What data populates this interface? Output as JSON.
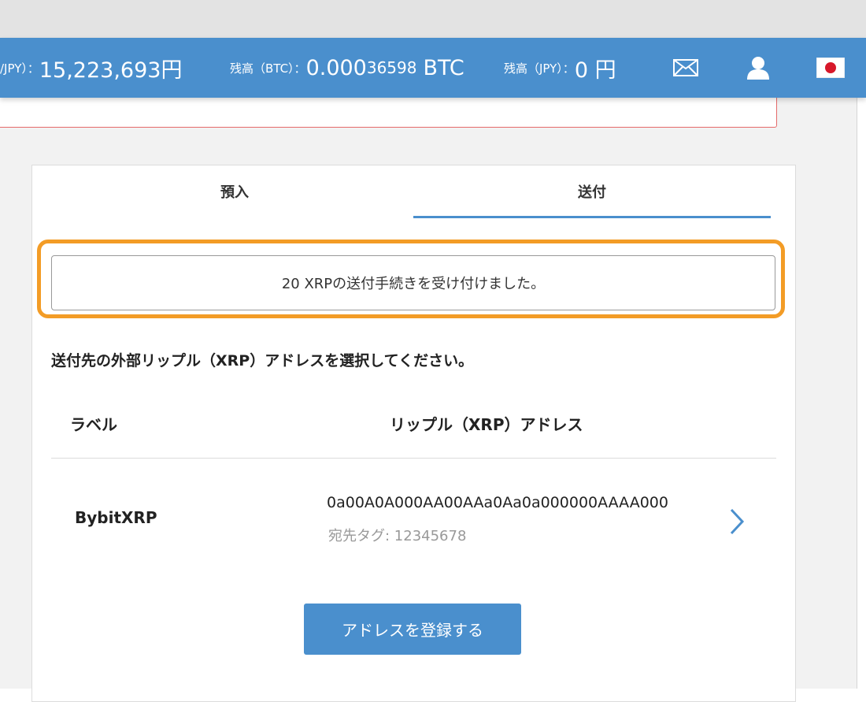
{
  "header": {
    "rate_label_partial": "/JPY）：",
    "rate_value": "15,223,693円",
    "btc_balance_label": "残高（BTC）：",
    "btc_balance_strong": "0.000",
    "btc_balance_rest": "36598",
    "btc_unit": "BTC",
    "jpy_balance_label": "残高（JPY）：",
    "jpy_balance_value": "0 円",
    "icons": [
      "mail-icon",
      "user-icon",
      "japan-flag-icon"
    ]
  },
  "tabs": [
    {
      "label": "預入",
      "active": false
    },
    {
      "label": "送付",
      "active": true
    }
  ],
  "notice": "20 XRPの送付手続きを受け付けました。",
  "instruction": "送付先の外部リップル（XRP）アドレスを選択してください。",
  "table": {
    "headers": [
      "ラベル",
      "リップル（XRP）アドレス"
    ],
    "rows": [
      {
        "label": "BybitXRP",
        "address": "0a00A0A000AA00AAa0Aa0a000000AAAA000",
        "tag_label": "宛先タグ: ",
        "tag_value": "12345678"
      }
    ]
  },
  "register_button": "アドレスを登録する",
  "colors": {
    "header_blue": "#4a8fcd",
    "highlight_orange": "#f39c26",
    "alert_red": "#e56a6a"
  }
}
